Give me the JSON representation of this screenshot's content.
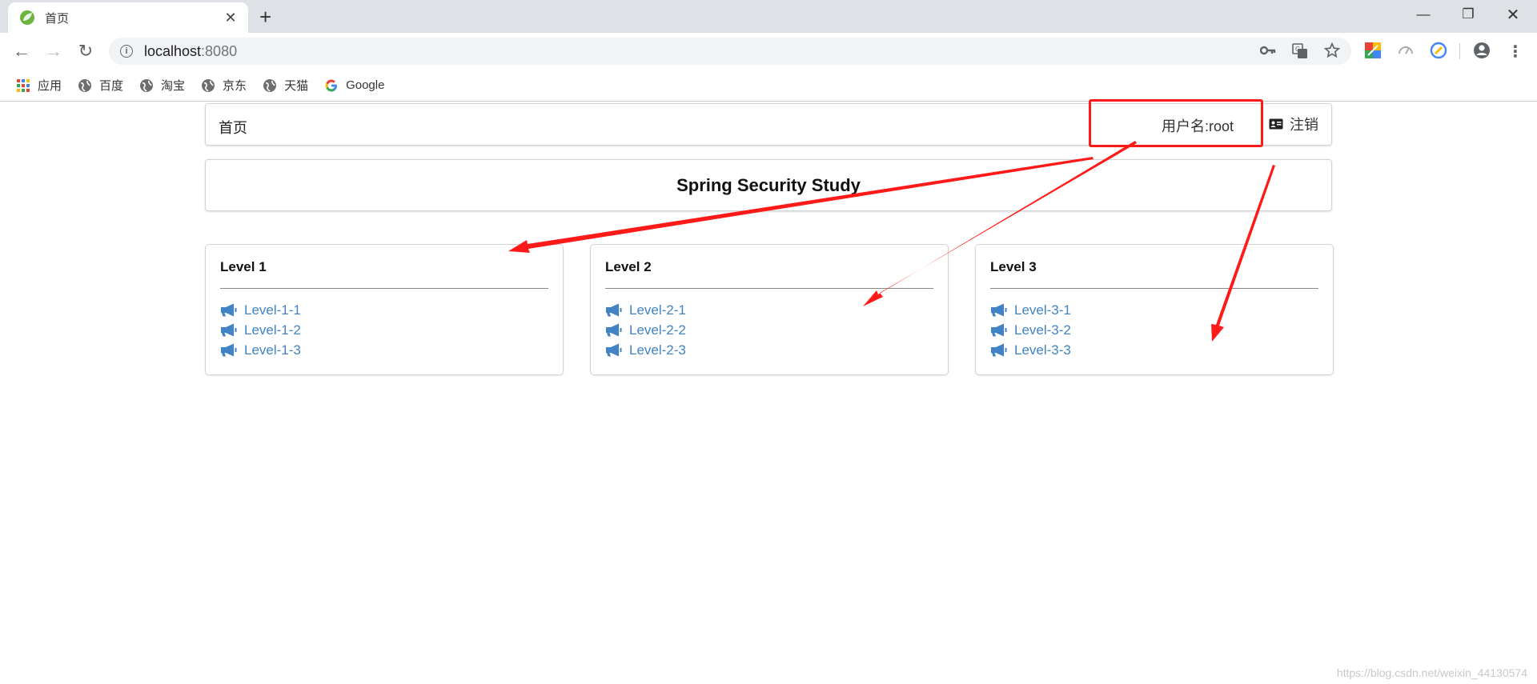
{
  "browser": {
    "tab_title": "首页",
    "url_host": "localhost",
    "url_port": ":8080",
    "bookmarks": [
      "应用",
      "百度",
      "淘宝",
      "京东",
      "天猫",
      "Google"
    ]
  },
  "page": {
    "menu": {
      "home": "首页",
      "username": "用户名:root",
      "logout": "注销"
    },
    "title": "Spring Security Study",
    "cards": [
      {
        "heading": "Level 1",
        "links": [
          "Level-1-1",
          "Level-1-2",
          "Level-1-3"
        ]
      },
      {
        "heading": "Level 2",
        "links": [
          "Level-2-1",
          "Level-2-2",
          "Level-2-3"
        ]
      },
      {
        "heading": "Level 3",
        "links": [
          "Level-3-1",
          "Level-3-2",
          "Level-3-3"
        ]
      }
    ]
  },
  "watermark": "https://blog.csdn.net/weixin_44130574",
  "colors": {
    "link": "#4183c4",
    "annotation": "#ff1a1a",
    "tabbar": "#dee1e6"
  },
  "icons": {
    "link_icon": "bullhorn-icon",
    "logout_icon": "id-card-icon"
  }
}
